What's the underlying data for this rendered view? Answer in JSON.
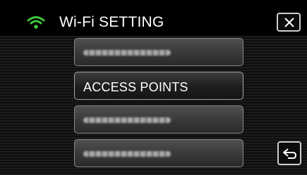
{
  "header": {
    "title": "Wi-Fi SETTING",
    "wifi_icon": "wifi-icon",
    "wifi_color": "#3ec93e",
    "close_icon": "close-icon"
  },
  "menu": {
    "items": [
      {
        "label": "",
        "state": "blurred"
      },
      {
        "label": "ACCESS POINTS",
        "state": "selected"
      },
      {
        "label": "",
        "state": "blurred"
      },
      {
        "label": "",
        "state": "blurred"
      }
    ]
  },
  "footer": {
    "back_icon": "return-icon"
  }
}
